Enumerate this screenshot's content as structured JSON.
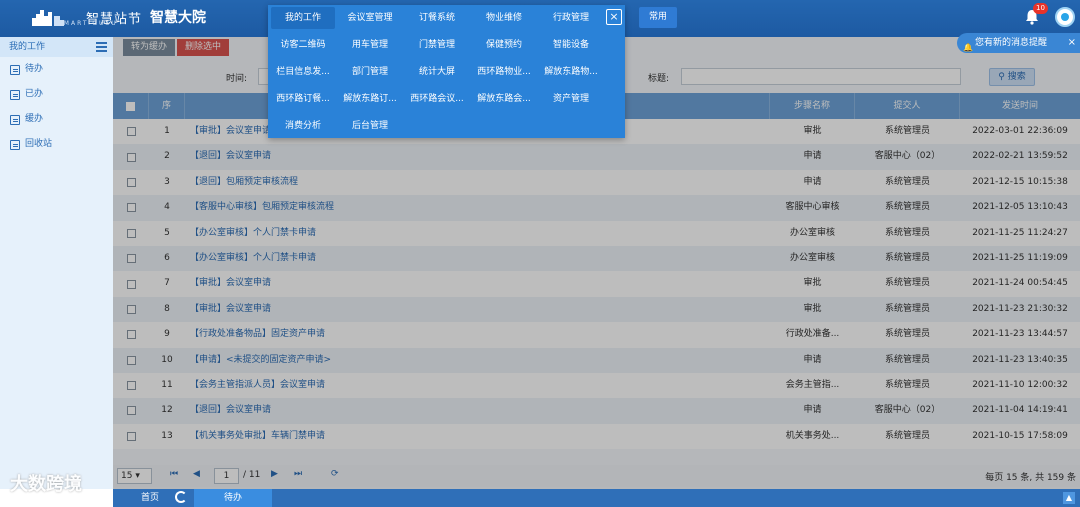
{
  "header": {
    "logo_text": "智慧站节",
    "logo_subtext": "SMART GUSU",
    "app_title": "智慧大院",
    "common_label": "常用",
    "notification_count": "10",
    "notice_text": "您有新的消息提醒",
    "notice_close": "×"
  },
  "menu": {
    "items": [
      "我的工作",
      "会议室管理",
      "订餐系统",
      "物业维修",
      "行政管理",
      "访客二维码",
      "用车管理",
      "门禁管理",
      "保健预约",
      "智能设备",
      "栏目信息发...",
      "部门管理",
      "统计大屏",
      "西环路物业...",
      "解放东路物...",
      "西环路订餐...",
      "解放东路订...",
      "西环路会议...",
      "解放东路会...",
      "资产管理",
      "消费分析",
      "后台管理"
    ],
    "close_label": "×"
  },
  "sidebar": {
    "heading": "我的工作",
    "items": [
      "待办",
      "已办",
      "缓办",
      "回收站"
    ]
  },
  "toolbar": {
    "defer_label": "转为缓办",
    "delete_label": "删除选中"
  },
  "filters": {
    "time_label": "时间:",
    "title_label": "标题:",
    "search_label": "搜索"
  },
  "table": {
    "columns": {
      "no": "序",
      "step": "步骤名称",
      "submitter": "提交人",
      "time": "发送时间"
    },
    "rows": [
      {
        "no": "1",
        "title": "【审批】会议室申请",
        "step": "审批",
        "submitter": "系统管理员",
        "time": "2022-03-01 22:36:09"
      },
      {
        "no": "2",
        "title": "【退回】会议室申请",
        "step": "申请",
        "submitter": "客服中心（02）",
        "time": "2022-02-21 13:59:52"
      },
      {
        "no": "3",
        "title": "【退回】包厢预定审核流程",
        "step": "申请",
        "submitter": "系统管理员",
        "time": "2021-12-15 10:15:38"
      },
      {
        "no": "4",
        "title": "【客服中心审核】包厢预定审核流程",
        "step": "客服中心审核",
        "submitter": "系统管理员",
        "time": "2021-12-05 13:10:43"
      },
      {
        "no": "5",
        "title": "【办公室审核】个人门禁卡申请",
        "step": "办公室审核",
        "submitter": "系统管理员",
        "time": "2021-11-25 11:24:27"
      },
      {
        "no": "6",
        "title": "【办公室审核】个人门禁卡申请",
        "step": "办公室审核",
        "submitter": "系统管理员",
        "time": "2021-11-25 11:19:09"
      },
      {
        "no": "7",
        "title": "【审批】会议室申请",
        "step": "审批",
        "submitter": "系统管理员",
        "time": "2021-11-24 00:54:45"
      },
      {
        "no": "8",
        "title": "【审批】会议室申请",
        "step": "审批",
        "submitter": "系统管理员",
        "time": "2021-11-23 21:30:32"
      },
      {
        "no": "9",
        "title": "【行政处准备物品】固定资产申请",
        "step": "行政处准备...",
        "submitter": "系统管理员",
        "time": "2021-11-23 13:44:57"
      },
      {
        "no": "10",
        "title": "【申请】<未提交的固定资产申请>",
        "step": "申请",
        "submitter": "系统管理员",
        "time": "2021-11-23 13:40:35"
      },
      {
        "no": "11",
        "title": "【会务主管指派人员】会议室申请",
        "step": "会务主管指...",
        "submitter": "系统管理员",
        "time": "2021-11-10 12:00:32"
      },
      {
        "no": "12",
        "title": "【退回】会议室申请",
        "step": "申请",
        "submitter": "客服中心（02）",
        "time": "2021-11-04 14:19:41"
      },
      {
        "no": "13",
        "title": "【机关事务处审批】车辆门禁申请",
        "step": "机关事务处...",
        "submitter": "系统管理员",
        "time": "2021-10-15 17:58:09"
      }
    ]
  },
  "pager": {
    "page_size": "15",
    "current_page": "1",
    "total_pages": "/ 11",
    "info": "每页 15 条, 共 159 条"
  },
  "bottom": {
    "home_label": "首页",
    "active_tab": "待办"
  },
  "watermark": "大数跨境"
}
